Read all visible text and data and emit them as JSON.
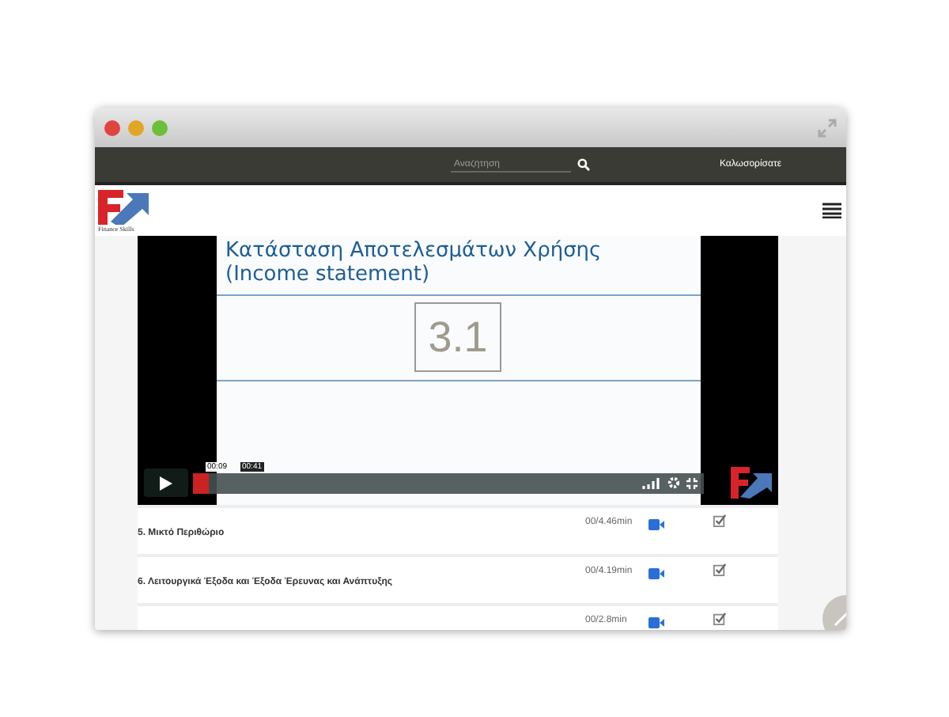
{
  "nav": {
    "search": {
      "placeholder": "Αναζήτηση"
    },
    "welcome": "Καλωσορίσατε"
  },
  "header": {
    "logo_caption": "Finance Skills"
  },
  "video": {
    "slide": {
      "title": "Κατάσταση Αποτελεσμάτων Χρήσης",
      "subtitle": "(Income statement)",
      "number": "3.1"
    },
    "player": {
      "current_time": "00:09",
      "total_time": "00:41",
      "level": 0.03
    }
  },
  "lessons": [
    {
      "title": "5. Μικτό Περιθώριο",
      "duration": "00/4.46min",
      "checked": true
    },
    {
      "title": "6. Λειτουργικά Έξοδα και Έξοδα Έρευνας και Ανάπτυξης",
      "duration": "00/4.19min",
      "checked": true
    },
    {
      "duration": "00/2.8min",
      "checked": true
    }
  ]
}
